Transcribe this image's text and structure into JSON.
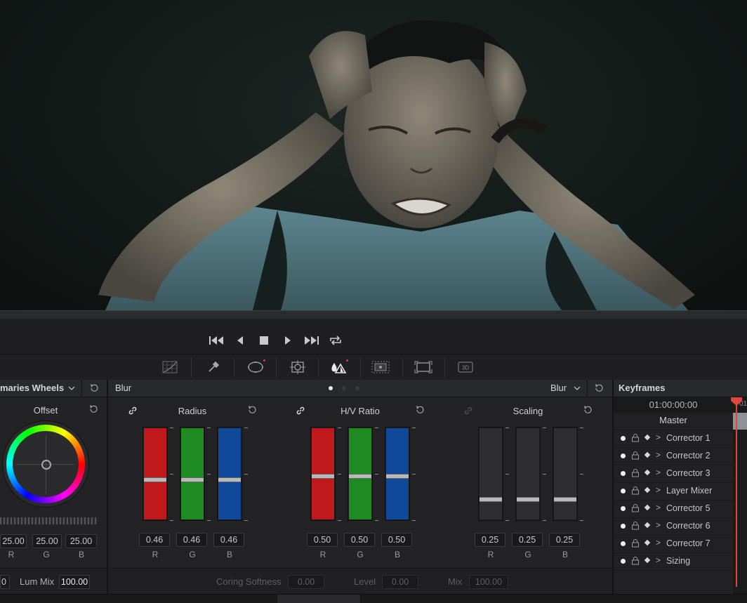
{
  "transport": {
    "prev_label": "⏮",
    "back_label": "◀",
    "stop_label": "■",
    "play_label": "▶",
    "next_label": "⏭",
    "loop_label": "⟳"
  },
  "primaries": {
    "title": "maries Wheels",
    "wheel_title": "Offset",
    "values": [
      "25.00",
      "25.00",
      "25.00"
    ],
    "channels": [
      "R",
      "G",
      "B"
    ],
    "lum_left": "0",
    "lum_mix_label": "Lum Mix",
    "lum_mix_value": "100.00"
  },
  "blur": {
    "title": "Blur",
    "mode": "Blur",
    "sections": [
      {
        "title": "Radius",
        "values": [
          "0.46",
          "0.46",
          "0.46"
        ],
        "channels": [
          "R",
          "G",
          "B"
        ],
        "levels": [
          0.46,
          0.46,
          0.46
        ]
      },
      {
        "title": "H/V Ratio",
        "values": [
          "0.50",
          "0.50",
          "0.50"
        ],
        "channels": [
          "R",
          "G",
          "B"
        ],
        "levels": [
          0.5,
          0.5,
          0.5
        ]
      },
      {
        "title": "Scaling",
        "values": [
          "0.25",
          "0.25",
          "0.25"
        ],
        "channels": [
          "R",
          "G",
          "B"
        ],
        "levels": [
          0.25,
          0.25,
          0.25
        ]
      }
    ],
    "coring_label": "Coring Softness",
    "coring_value": "0.00",
    "level_label": "Level",
    "level_value": "0.00",
    "mix_label": "Mix",
    "mix_value": "100.00"
  },
  "keyframes": {
    "title": "Keyframes",
    "timecode": "01:00:00:00",
    "ruler_mark": "01",
    "master": "Master",
    "rows": [
      "Corrector 1",
      "Corrector 2",
      "Corrector 3",
      "Layer Mixer",
      "Corrector 5",
      "Corrector 6",
      "Corrector 7",
      "Sizing"
    ]
  },
  "colors": {
    "red": "#c0191c",
    "green": "#1d8a22",
    "blue": "#10499a",
    "playhead": "#e0473c"
  }
}
